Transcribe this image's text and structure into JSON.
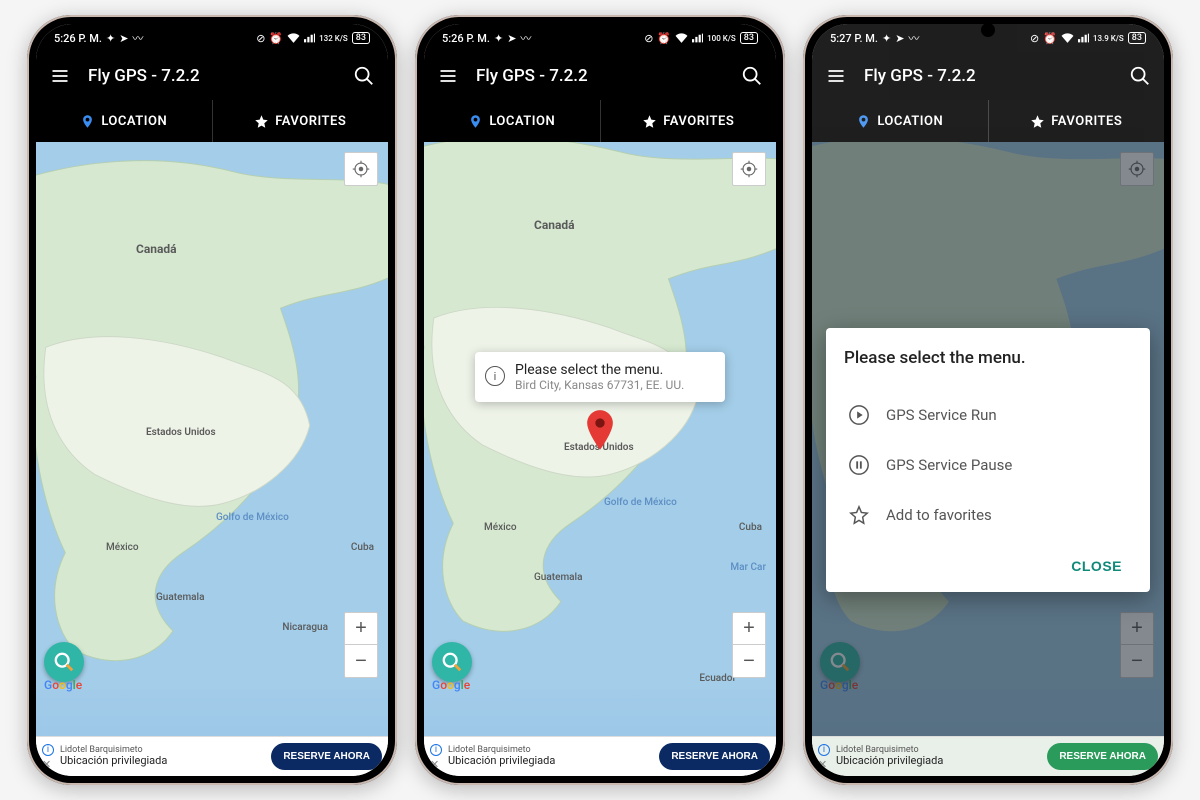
{
  "statusbar": {
    "time_a": "5:26 P. M.",
    "time_b": "5:26 P. M.",
    "time_c": "5:27 P. M.",
    "net_a": "132 K/S",
    "net_b": "100 K/S",
    "net_c": "13.9 K/S",
    "battery": "83"
  },
  "app": {
    "title": "Fly GPS - 7.2.2"
  },
  "tabs": {
    "location": "LOCATION",
    "favorites": "FAVORITES"
  },
  "map_labels": {
    "canada": "Canadá",
    "mexico": "México",
    "gulf": "Golfo de México",
    "cuba": "Cuba",
    "guatemala": "Guatemala",
    "nicaragua": "Nicaragua",
    "ecuador": "Ecuador",
    "marcar": "Mar Car",
    "usa": "Estados Unidos"
  },
  "infowindow": {
    "title": "Please select the menu.",
    "subtitle": "Bird City, Kansas 67731, EE. UU."
  },
  "dialog": {
    "title": "Please select the menu.",
    "run": "GPS Service Run",
    "pause": "GPS Service Pause",
    "fav": "Add to favorites",
    "close": "CLOSE"
  },
  "ad": {
    "line1": "Lidotel Barquisimeto",
    "line2": "Ubicación privilegiada",
    "cta": "RESERVE AHORA"
  },
  "zoom": {
    "in": "+",
    "out": "−"
  }
}
